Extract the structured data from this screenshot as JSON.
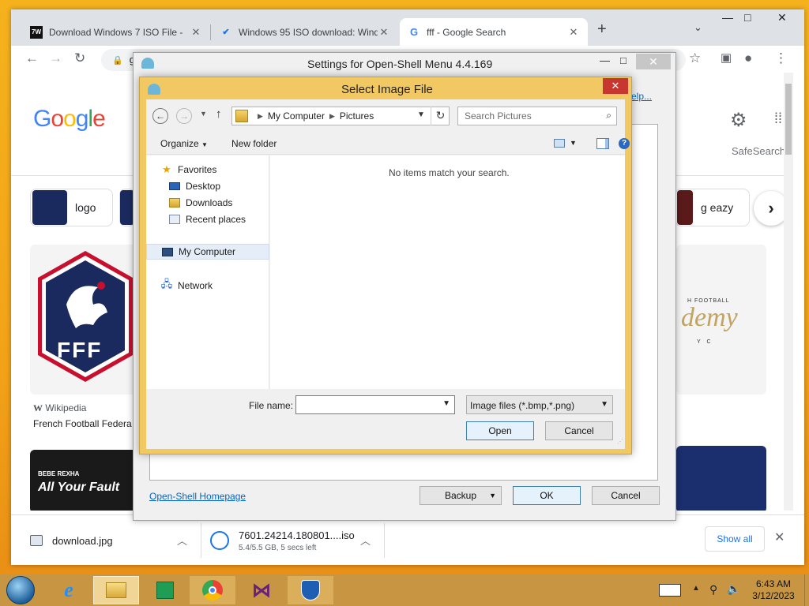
{
  "browser": {
    "tabs": [
      {
        "title": "Download Windows 7 ISO File -",
        "favicon": "7w-icon"
      },
      {
        "title": "Windows 95 ISO download: Wind",
        "favicon": "check-icon"
      },
      {
        "title": "fff - Google Search",
        "favicon": "google-icon"
      }
    ],
    "omnibox_text": "g"
  },
  "google": {
    "logo": "Google",
    "safesearch": "SafeSearch",
    "help_link": "elp...",
    "chips": [
      {
        "label": "logo"
      },
      {
        "label": "g eazy"
      }
    ],
    "results": [
      {
        "source": "Wikipedia",
        "title": "French Football Federa"
      }
    ],
    "fff_text": "FFF",
    "rexha_caption": "BEBE REXHA",
    "rexha_title": "All Your Fault",
    "academy_top": "H FOOTBALL",
    "academy_script": "demy",
    "academy_bottom": "Y C"
  },
  "downloads": {
    "items": [
      {
        "name": "download.jpg",
        "status": ""
      },
      {
        "name": "7601.24214.180801....iso",
        "status": "5.4/5.5 GB, 5 secs left"
      }
    ],
    "show_all": "Show all"
  },
  "settings_window": {
    "title": "Settings for Open-Shell Menu 4.4.169",
    "homepage_link": "Open-Shell Homepage",
    "backup_label": "Backup",
    "ok_label": "OK",
    "cancel_label": "Cancel"
  },
  "dialog": {
    "title": "Select Image File",
    "breadcrumb": [
      "My Computer",
      "Pictures"
    ],
    "search_placeholder": "Search Pictures",
    "organize_label": "Organize",
    "new_folder_label": "New folder",
    "nav": {
      "favorites": "Favorites",
      "desktop": "Desktop",
      "downloads": "Downloads",
      "recent": "Recent places",
      "computer": "My Computer",
      "network": "Network"
    },
    "empty_message": "No items match your search.",
    "file_name_label": "File name:",
    "file_name_value": "",
    "file_type": "Image files (*.bmp,*.png)",
    "open_label": "Open",
    "cancel_label": "Cancel"
  },
  "taskbar": {
    "apps": [
      "internet-explorer",
      "file-explorer",
      "store",
      "chrome",
      "visual-studio",
      "shield"
    ],
    "time": "6:43 AM",
    "date": "3/12/2023"
  },
  "colors": {
    "dialog_frame": "#f1c862",
    "close_red": "#c7372f",
    "link_blue": "#0066cc",
    "wallpaper": "#f3a218"
  }
}
